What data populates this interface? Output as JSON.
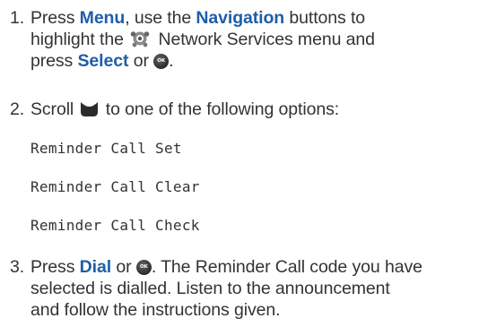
{
  "steps": [
    {
      "number": "1.",
      "parts": {
        "t1": "Press ",
        "k1": "Menu",
        "t2": ", use the ",
        "k2": "Navigation",
        "t3": " buttons to",
        "t4": "highlight the ",
        "t5": " Network Services menu and",
        "t6": "press ",
        "k3": "Select",
        "t7": " or ",
        "t8": "."
      },
      "icons": [
        "network-services-icon",
        "ok-button-icon"
      ]
    },
    {
      "number": "2.",
      "parts": {
        "t1": "Scroll ",
        "t2": " to one of the following options:"
      },
      "icons": [
        "scroll-icon"
      ]
    },
    {
      "number": "3.",
      "parts": {
        "t1": "Press ",
        "k1": "Dial",
        "t2": " or ",
        "t3": ". The Reminder Call code you have",
        "t4": "selected is dialled. Listen to the announcement",
        "t5": "and follow the instructions given."
      },
      "icons": [
        "ok-button-icon"
      ]
    }
  ],
  "options": [
    "Reminder Call Set",
    "Reminder Call Clear",
    "Reminder Call Check"
  ],
  "ok_icon_label": "OK",
  "colors": {
    "text": "#333333",
    "keyword": "#1f5ea8",
    "background": "#ffffff"
  }
}
